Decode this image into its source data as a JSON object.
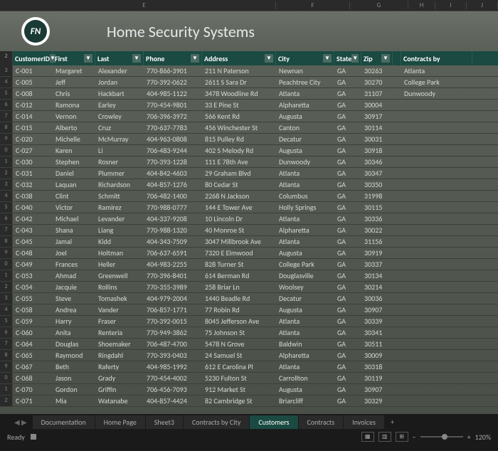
{
  "columns_letters": [
    "E",
    "F",
    "G",
    "H",
    "I",
    "J"
  ],
  "app_title": "Home Security Systems",
  "logo_text": "FN",
  "headers": {
    "customer_id": "CustomerID",
    "first": "First",
    "last": "Last",
    "phone": "Phone",
    "address": "Address",
    "city": "City",
    "state": "State",
    "zip": "Zip",
    "contracts": "Contracts by"
  },
  "rows": [
    {
      "n": "3",
      "id": "C-001",
      "first": "Margaret",
      "last": "Alexander",
      "phone": "770-866-3901",
      "address": "211 N Paterson",
      "city": "Newnan",
      "state": "GA",
      "zip": "30263",
      "contracts": "Atlanta"
    },
    {
      "n": "4",
      "id": "C-005",
      "first": "Jeff",
      "last": "Jordan",
      "phone": "770-392-0622",
      "address": "2611 S Sara Dr",
      "city": "Peachtree City",
      "state": "GA",
      "zip": "30270",
      "contracts": "College Park"
    },
    {
      "n": "5",
      "id": "C-008",
      "first": "Chris",
      "last": "Hackbart",
      "phone": "404-985-1122",
      "address": "3478 Woodline Rd",
      "city": "Atlanta",
      "state": "GA",
      "zip": "31107",
      "contracts": "Dunwoody"
    },
    {
      "n": "6",
      "id": "C-012",
      "first": "Ramona",
      "last": "Earley",
      "phone": "770-454-9801",
      "address": "33 E Pine St",
      "city": "Alpharetta",
      "state": "GA",
      "zip": "30004",
      "contracts": ""
    },
    {
      "n": "7",
      "id": "C-014",
      "first": "Vernon",
      "last": "Crowley",
      "phone": "706-396-3972",
      "address": "566 Kent Rd",
      "city": "Augusta",
      "state": "GA",
      "zip": "30917",
      "contracts": ""
    },
    {
      "n": "8",
      "id": "C-015",
      "first": "Alberto",
      "last": "Cruz",
      "phone": "770-637-7783",
      "address": "456 Winchester St",
      "city": "Canton",
      "state": "GA",
      "zip": "30114",
      "contracts": ""
    },
    {
      "n": "9",
      "id": "C-020",
      "first": "Michelle",
      "last": "McMurray",
      "phone": "404-963-0808",
      "address": "815 Pulley Rd",
      "city": "Decatur",
      "state": "GA",
      "zip": "30031",
      "contracts": ""
    },
    {
      "n": "0",
      "id": "C-027",
      "first": "Karen",
      "last": "Li",
      "phone": "706-483-9244",
      "address": "402 S Melody Rd",
      "city": "Augusta",
      "state": "GA",
      "zip": "30918",
      "contracts": ""
    },
    {
      "n": "1",
      "id": "C-030",
      "first": "Stephen",
      "last": "Rosner",
      "phone": "770-393-1228",
      "address": "111 E 78th Ave",
      "city": "Dunwoody",
      "state": "GA",
      "zip": "30346",
      "contracts": ""
    },
    {
      "n": "2",
      "id": "C-031",
      "first": "Daniel",
      "last": "Plummer",
      "phone": "404-842-4603",
      "address": "29 Graham Blvd",
      "city": "Atlanta",
      "state": "GA",
      "zip": "30347",
      "contracts": ""
    },
    {
      "n": "3",
      "id": "C-032",
      "first": "Laquan",
      "last": "Richardson",
      "phone": "404-857-1276",
      "address": "80 Cedar St",
      "city": "Atlanta",
      "state": "GA",
      "zip": "30350",
      "contracts": ""
    },
    {
      "n": "4",
      "id": "C-038",
      "first": "Clint",
      "last": "Schmitt",
      "phone": "706-482-1400",
      "address": "2268 N Jackson",
      "city": "Columbus",
      "state": "GA",
      "zip": "31998",
      "contracts": ""
    },
    {
      "n": "5",
      "id": "C-040",
      "first": "Victor",
      "last": "Ramirez",
      "phone": "770-988-0777",
      "address": "144 E Tower Ave",
      "city": "Holly Springs",
      "state": "GA",
      "zip": "30115",
      "contracts": ""
    },
    {
      "n": "6",
      "id": "C-042",
      "first": "Michael",
      "last": "Levander",
      "phone": "404-337-9208",
      "address": "10 Lincoln Dr",
      "city": "Atlanta",
      "state": "GA",
      "zip": "30336",
      "contracts": ""
    },
    {
      "n": "7",
      "id": "C-043",
      "first": "Shana",
      "last": "Liang",
      "phone": "770-988-1320",
      "address": "40 Monroe St",
      "city": "Alpharetta",
      "state": "GA",
      "zip": "30022",
      "contracts": ""
    },
    {
      "n": "8",
      "id": "C-045",
      "first": "Jamal",
      "last": "Kidd",
      "phone": "404-343-7509",
      "address": "3047 Millbrook Ave",
      "city": "Atlanta",
      "state": "GA",
      "zip": "31156",
      "contracts": ""
    },
    {
      "n": "9",
      "id": "C-048",
      "first": "Joel",
      "last": "Holtman",
      "phone": "706-637-6591",
      "address": "7320 E Elmwood",
      "city": "Augusta",
      "state": "GA",
      "zip": "30919",
      "contracts": ""
    },
    {
      "n": "0",
      "id": "C-049",
      "first": "Frances",
      "last": "Heller",
      "phone": "404-983-2255",
      "address": "828 Turner St",
      "city": "College Park",
      "state": "GA",
      "zip": "30337",
      "contracts": ""
    },
    {
      "n": "1",
      "id": "C-053",
      "first": "Ahmad",
      "last": "Greenwell",
      "phone": "770-396-8401",
      "address": "614 Berman Rd",
      "city": "Douglasville",
      "state": "GA",
      "zip": "30134",
      "contracts": ""
    },
    {
      "n": "2",
      "id": "C-054",
      "first": "Jacquie",
      "last": "Rollins",
      "phone": "770-355-3989",
      "address": "258 Briar Ln",
      "city": "Woolsey",
      "state": "GA",
      "zip": "30214",
      "contracts": ""
    },
    {
      "n": "3",
      "id": "C-055",
      "first": "Steve",
      "last": "Tomashek",
      "phone": "404-979-2004",
      "address": "1440 Beadle Rd",
      "city": "Decatur",
      "state": "GA",
      "zip": "30036",
      "contracts": ""
    },
    {
      "n": "4",
      "id": "C-058",
      "first": "Andrea",
      "last": "Vander",
      "phone": "706-857-1771",
      "address": "77 Robin Rd",
      "city": "Augusta",
      "state": "GA",
      "zip": "30907",
      "contracts": ""
    },
    {
      "n": "5",
      "id": "C-059",
      "first": "Harry",
      "last": "Fraser",
      "phone": "770-392-0015",
      "address": "8045 Jefferson Ave",
      "city": "Atlanta",
      "state": "GA",
      "zip": "30339",
      "contracts": ""
    },
    {
      "n": "6",
      "id": "C-060",
      "first": "Anita",
      "last": "Renteria",
      "phone": "770-949-3862",
      "address": "75 Johnson St",
      "city": "Atlanta",
      "state": "GA",
      "zip": "30341",
      "contracts": ""
    },
    {
      "n": "7",
      "id": "C-064",
      "first": "Douglas",
      "last": "Shoemaker",
      "phone": "706-487-4700",
      "address": "5478 N Grove",
      "city": "Baldwin",
      "state": "GA",
      "zip": "30511",
      "contracts": ""
    },
    {
      "n": "8",
      "id": "C-065",
      "first": "Raymond",
      "last": "Ringdahl",
      "phone": "770-393-0403",
      "address": "24 Samuel St",
      "city": "Alpharetta",
      "state": "GA",
      "zip": "30009",
      "contracts": ""
    },
    {
      "n": "9",
      "id": "C-067",
      "first": "Beth",
      "last": "Raferty",
      "phone": "404-985-1992",
      "address": "612 E Carolina Pl",
      "city": "Atlanta",
      "state": "GA",
      "zip": "30318",
      "contracts": ""
    },
    {
      "n": "0",
      "id": "C-068",
      "first": "Jason",
      "last": "Grady",
      "phone": "770-454-4002",
      "address": "5230 Fulton St",
      "city": "Carrollton",
      "state": "GA",
      "zip": "30119",
      "contracts": ""
    },
    {
      "n": "1",
      "id": "C-070",
      "first": "Gordon",
      "last": "Griffin",
      "phone": "706-456-7093",
      "address": "912 Market St",
      "city": "Augusta",
      "state": "GA",
      "zip": "30907",
      "contracts": ""
    },
    {
      "n": "2",
      "id": "C-071",
      "first": "Mia",
      "last": "Watanabe",
      "phone": "404-857-4424",
      "address": "82 Cambridge St",
      "city": "Briarcliff",
      "state": "GA",
      "zip": "30329",
      "contracts": ""
    }
  ],
  "sheets": [
    "Documentation",
    "Home Page",
    "Sheet3",
    "Contracts by City",
    "Customers",
    "Contracts",
    "Invoices"
  ],
  "active_sheet": 4,
  "status": {
    "ready": "Ready",
    "zoom": "120%"
  }
}
